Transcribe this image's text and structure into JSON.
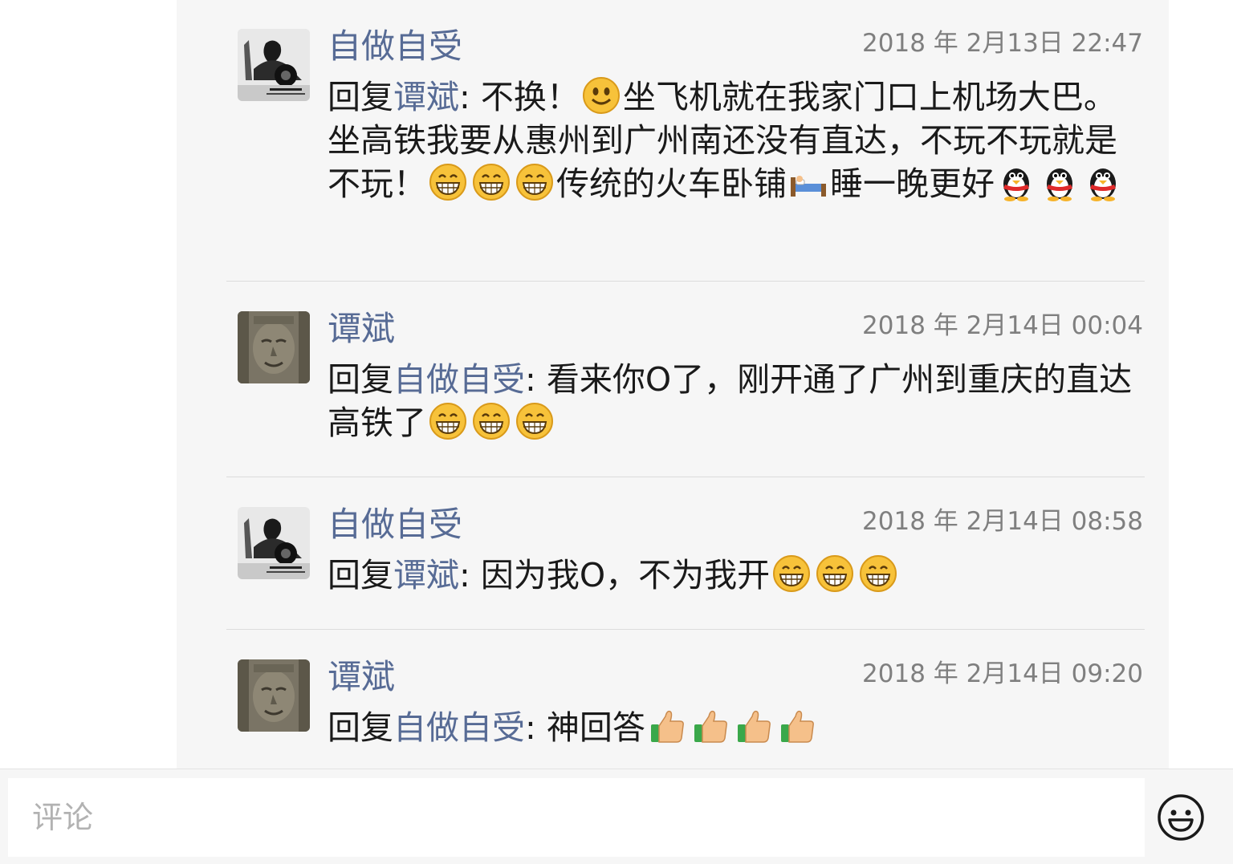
{
  "comments": [
    {
      "author": "自做自受",
      "time": "2018 年 2月13日 22:47",
      "reply_prefix": "回复",
      "reply_to": "谭斌",
      "text_before": ": 不换！",
      "text_middle": "坐飞机就在我家门口上机场大巴。坐高铁我要从惠州到广州南还没有直达，不玩不玩就是不玩！",
      "text_after": "传统的火车卧铺",
      "text_end": "睡一晚更好",
      "emojis": [
        "smile-emoji",
        "grin-emoji",
        "grin-emoji",
        "grin-emoji",
        "bed-emoji",
        "qq-penguin-emoji",
        "qq-penguin-emoji",
        "qq-penguin-emoji"
      ]
    },
    {
      "author": "谭斌",
      "time": "2018 年 2月14日 00:04",
      "reply_prefix": "回复",
      "reply_to": "自做自受",
      "text": ": 看来你O了，刚开通了广州到重庆的直达高铁了",
      "emojis": [
        "grin-emoji",
        "grin-emoji",
        "grin-emoji"
      ]
    },
    {
      "author": "自做自受",
      "time": "2018 年 2月14日 08:58",
      "reply_prefix": "回复",
      "reply_to": "谭斌",
      "text": ": 因为我O，不为我开",
      "emojis": [
        "grin-emoji",
        "grin-emoji",
        "grin-emoji"
      ]
    },
    {
      "author": "谭斌",
      "time": "2018 年 2月14日 09:20",
      "reply_prefix": "回复",
      "reply_to": "自做自受",
      "text": ": 神回答",
      "emojis": [
        "thumbs-up-emoji",
        "thumbs-up-emoji",
        "thumbs-up-emoji",
        "thumbs-up-emoji"
      ]
    }
  ],
  "input": {
    "placeholder": "评论",
    "emoji_button_icon": "smiley-face-icon"
  },
  "colors": {
    "link": "#576b95",
    "panel_bg": "#f6f6f6",
    "time": "#7f7f7f"
  }
}
